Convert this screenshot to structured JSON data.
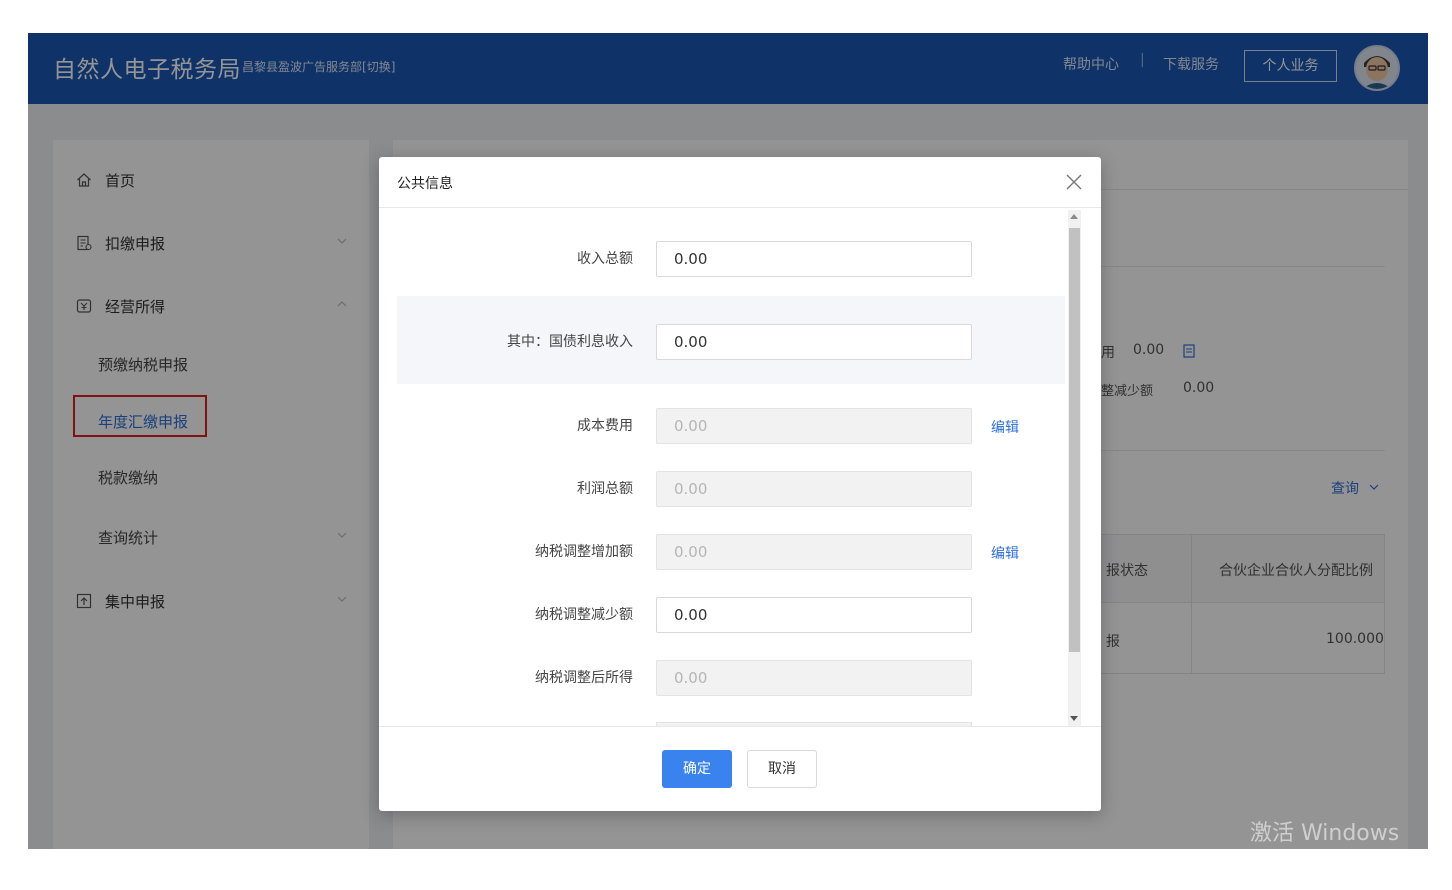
{
  "header": {
    "title": "自然人电子税务局",
    "org": "昌黎县盈波广告服务部",
    "switch_label": "[切换]",
    "help": "帮助中心",
    "separator": "|",
    "download": "下载服务",
    "personal": "个人业务",
    "colors": {
      "bar": "#1a56b4"
    }
  },
  "sidebar": {
    "items": [
      {
        "label": "首页",
        "icon": "home-icon"
      },
      {
        "label": "扣缴申报",
        "icon": "form-icon"
      },
      {
        "label": "经营所得",
        "icon": "tax-icon"
      },
      {
        "label": "预缴纳税申报"
      },
      {
        "label": "年度汇缴申报",
        "active": true
      },
      {
        "label": "税款缴纳"
      },
      {
        "label": "查询统计"
      },
      {
        "label": "集中申报",
        "icon": "upload-icon"
      }
    ]
  },
  "background": {
    "cost_fragment": "用",
    "cost_value": "0.00",
    "reduce_fragment": "整减少额",
    "reduce_value": "0.00",
    "query": "查询",
    "col_status": "报状态",
    "col_ratio": "合伙企业合伙人分配比例",
    "cell_status": "报",
    "cell_ratio": "100.000"
  },
  "modal": {
    "title": "公共信息",
    "fields": [
      {
        "label": "收入总额",
        "value": "0.00",
        "editable": true
      },
      {
        "label": "其中：国债利息收入",
        "value": "0.00",
        "editable": true
      },
      {
        "label": "成本费用",
        "value": "0.00",
        "editable": false,
        "edit_link": "编辑"
      },
      {
        "label": "利润总额",
        "value": "0.00",
        "editable": false
      },
      {
        "label": "纳税调整增加额",
        "value": "0.00",
        "editable": false,
        "edit_link": "编辑"
      },
      {
        "label": "纳税调整减少额",
        "value": "0.00",
        "editable": true
      },
      {
        "label": "纳税调整后所得",
        "value": "0.00",
        "editable": false
      }
    ],
    "ok": "确定",
    "cancel": "取消",
    "colors": {
      "primary": "#3a83ef",
      "link": "#2f6fd8"
    }
  },
  "watermark": "激活 Windows"
}
